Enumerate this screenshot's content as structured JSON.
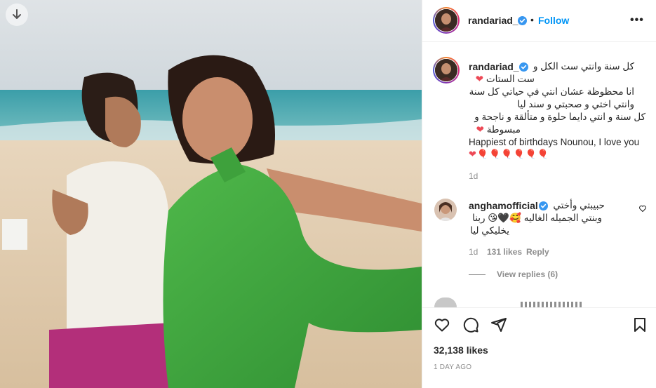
{
  "post": {
    "username": "randariad_",
    "follow_label": "Follow",
    "separator": "•",
    "more_label": "•••"
  },
  "caption": {
    "username": "randariad_",
    "line1": "كل سنة وانتي ست الكل و",
    "line2": "ست الستات",
    "line3": "انا محظوظة عشان انتي في حياتي كل سنة",
    "line4": "وانتي اختي و صحبتي و سند ليا",
    "line5": "كل سنة و انتي دايما حلوة و متألقة و ناجحة و",
    "line6": "مبسوطة",
    "line7": "Happiest of birthdays Nounou, I love you",
    "hearts": "❤🎈🎈🎈🎈🎈🎈",
    "time": "1d"
  },
  "comment": {
    "username": "anghamofficial",
    "text1": "حبيبتي وأختي",
    "text2": "وبنتي الجميله الغاليه 🥰🖤😘 ربنا",
    "text3": "يخليكي ليا",
    "time": "1d",
    "likes": "131 likes",
    "reply_label": "Reply",
    "view_replies": "View replies (6)"
  },
  "footer": {
    "likes": "32,138 likes",
    "time": "1 DAY AGO"
  },
  "colors": {
    "follow_blue": "#0095f6",
    "verified_blue": "#3897f0",
    "heart_red": "#ed4956"
  },
  "icons": {
    "download": "download-icon",
    "verified": "verified-badge-icon",
    "like": "heart-outline-icon",
    "comment": "comment-icon",
    "share": "paper-plane-icon",
    "save": "bookmark-icon",
    "comment_like": "small-heart-icon"
  }
}
